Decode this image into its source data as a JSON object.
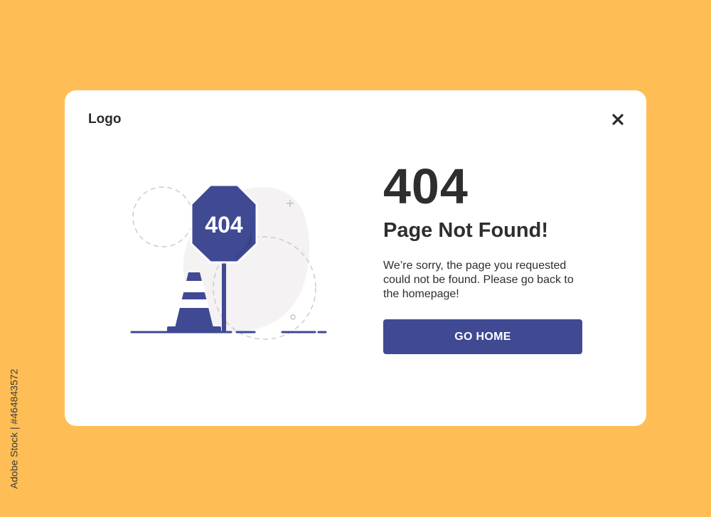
{
  "header": {
    "logo_text": "Logo",
    "close_icon": "close-icon"
  },
  "illustration": {
    "sign_text": "404",
    "icons": [
      "stop-sign-icon",
      "traffic-cone-icon"
    ]
  },
  "content": {
    "code": "404",
    "title": "Page Not Found!",
    "message": "We’re sorry, the page you requested could not be found. Please go back to the homepage!",
    "button_label": "GO HOME"
  },
  "side_credit": "Adobe Stock | #464843572",
  "colors": {
    "background": "#FFBE55",
    "card": "#FFFFFF",
    "accent": "#3F4A93",
    "text": "#2E2E2E"
  }
}
